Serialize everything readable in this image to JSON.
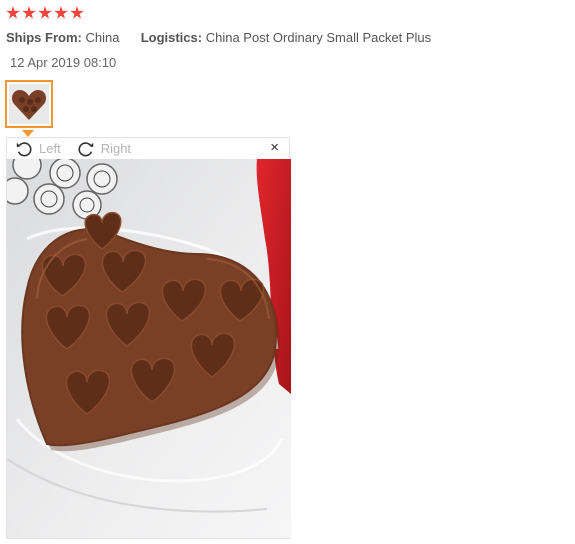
{
  "review": {
    "rating": 5,
    "ships_from_label": "Ships From:",
    "ships_from_value": "China",
    "logistics_label": "Logistics:",
    "logistics_value": "China Post Ordinary Small Packet Plus",
    "date": "12 Apr 2019 08:10"
  },
  "viewer": {
    "rotate_left_label": "Left",
    "rotate_right_label": "Right",
    "close_label": "×"
  },
  "colors": {
    "star": "#f0443b",
    "thumb_border": "#f19634",
    "mold": "#7a4027",
    "red_bag": "#d8232a"
  }
}
